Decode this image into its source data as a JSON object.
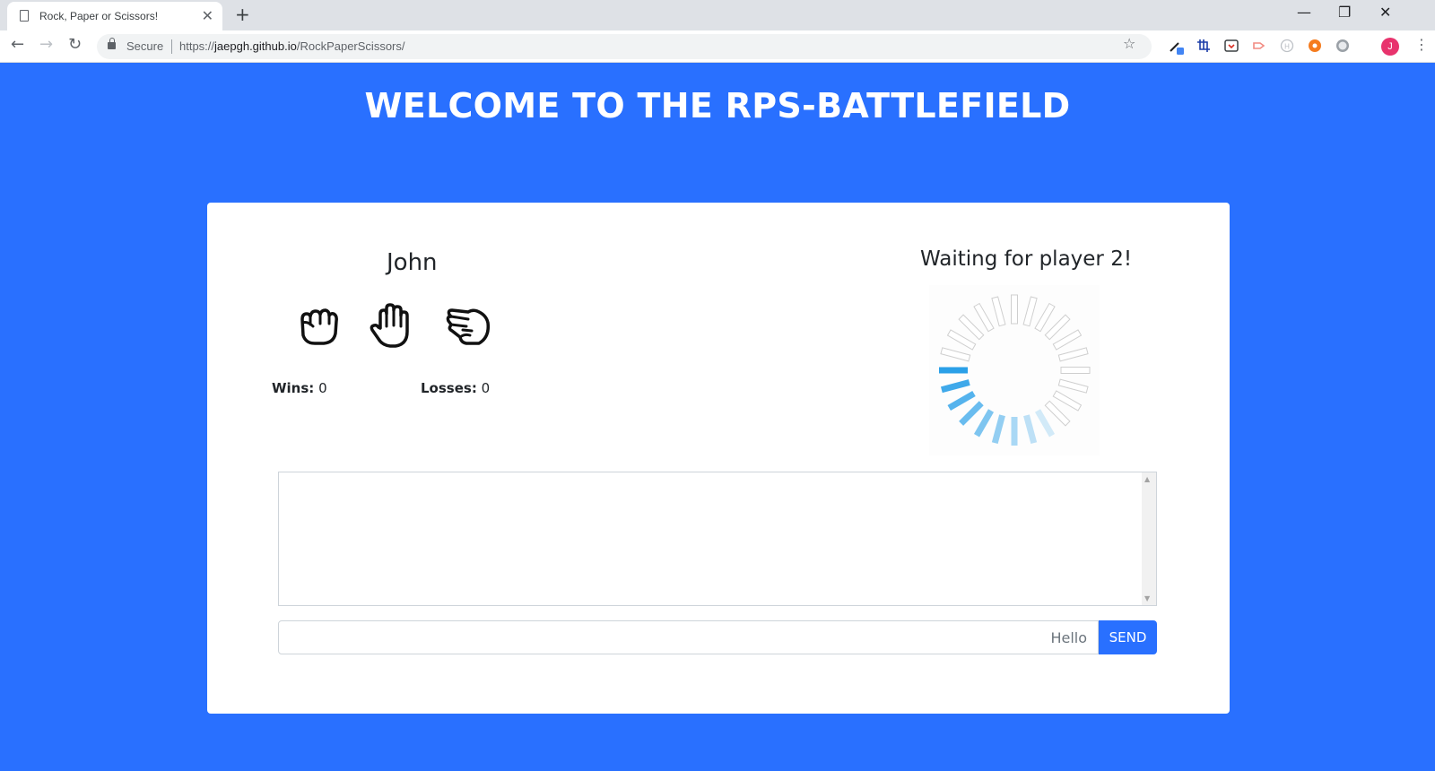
{
  "browser": {
    "tab_title": "Rock, Paper or Scissors!",
    "tab_close": "✕",
    "new_tab": "+",
    "minimize": "—",
    "restore": "❐",
    "close_window": "✕",
    "back": "←",
    "forward": "→",
    "reload": "↻",
    "secure_label": "Secure",
    "url_scheme": "https://",
    "url_host": "jaepgh.github.io",
    "url_path": "/RockPaperScissors/",
    "bookmark_star": "☆",
    "profile_initial": "J",
    "menu": "⋮",
    "extension_icons": [
      "pen-extension-icon",
      "crop-extension-icon",
      "pocket-extension-icon",
      "share-extension-icon",
      "hub-extension-icon",
      "orange-extension-icon",
      "gray-extension-icon"
    ]
  },
  "page": {
    "heading": "WELCOME TO THE RPS-BATTLEFIELD",
    "player1": {
      "name": "John",
      "choices": [
        "rock",
        "paper",
        "scissors"
      ],
      "wins_label": "Wins:",
      "wins": "0",
      "losses_label": "Losses:",
      "losses": "0"
    },
    "player2": {
      "status": "Waiting for player 2!"
    },
    "chat": {
      "input_value": "",
      "input_placeholder": "Hello",
      "send_label": "SEND"
    }
  },
  "colors": {
    "background": "#2970ff",
    "spinner_active": "#2aa0e8",
    "spinner_inactive": "#cfcfcf"
  }
}
